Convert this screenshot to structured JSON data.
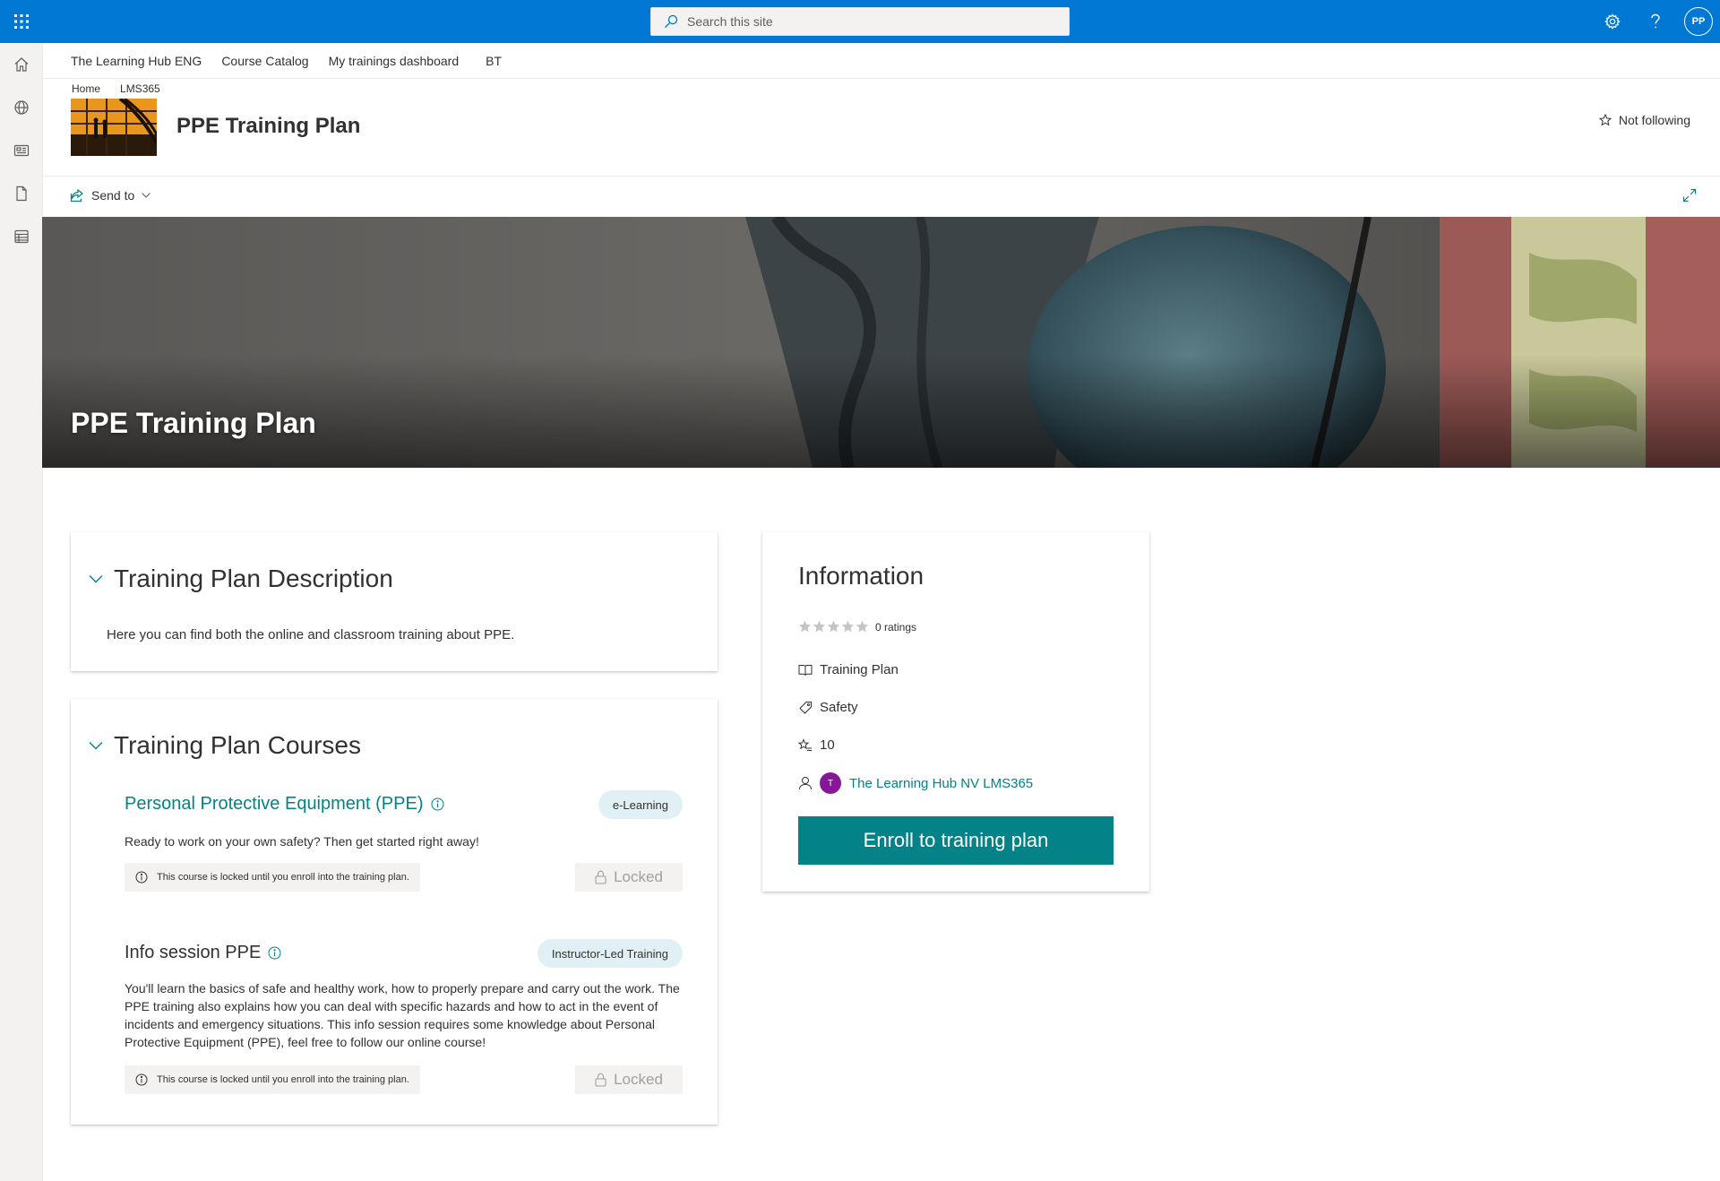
{
  "suite": {
    "search_placeholder": "Search this site",
    "user_initials": "PP"
  },
  "hub_nav": {
    "items": [
      "The Learning Hub ENG",
      "Course Catalog",
      "My trainings dashboard",
      "BT"
    ]
  },
  "breadcrumb": [
    "Home",
    "LMS365"
  ],
  "site": {
    "title": "PPE Training Plan",
    "follow_label": "Not following"
  },
  "command_bar": {
    "send_to": "Send to"
  },
  "hero": {
    "title": "PPE Training Plan"
  },
  "description": {
    "heading": "Training Plan Description",
    "text": "Here you can find both the online and classroom training about PPE."
  },
  "courses": {
    "heading": "Training Plan Courses",
    "items": [
      {
        "title": "Personal Protective Equipment (PPE)",
        "type": "e-Learning",
        "description": "Ready to work on your own safety? Then get started right away!",
        "lock_note": "This course is locked until you enroll into the training plan.",
        "status": "Locked",
        "title_color": "#038387"
      },
      {
        "title": "Info session PPE",
        "type": "Instructor-Led Training",
        "description": "You'll learn the basics of safe and healthy work, how to properly prepare and carry out the work. The PPE training also explains how you can deal with specific hazards and how to act in the event of incidents and emergency situations. This info session requires some knowledge about Personal Protective Equipment (PPE), feel free to follow our online course!",
        "lock_note": "This course is locked until you enroll into the training plan.",
        "status": "Locked",
        "title_color": "#323130"
      }
    ]
  },
  "information": {
    "heading": "Information",
    "ratings_label": "0 ratings",
    "rating_value": 0,
    "rating_max": 5,
    "type": "Training Plan",
    "category": "Safety",
    "points": "10",
    "owner_initial": "T",
    "owner": "The Learning Hub NV LMS365",
    "enroll_label": "Enroll to training plan"
  },
  "colors": {
    "suite_bar": "#0078d4",
    "accent_teal": "#038387",
    "badge_bg": "#e1f0f4",
    "owner_avatar": "#881798"
  }
}
